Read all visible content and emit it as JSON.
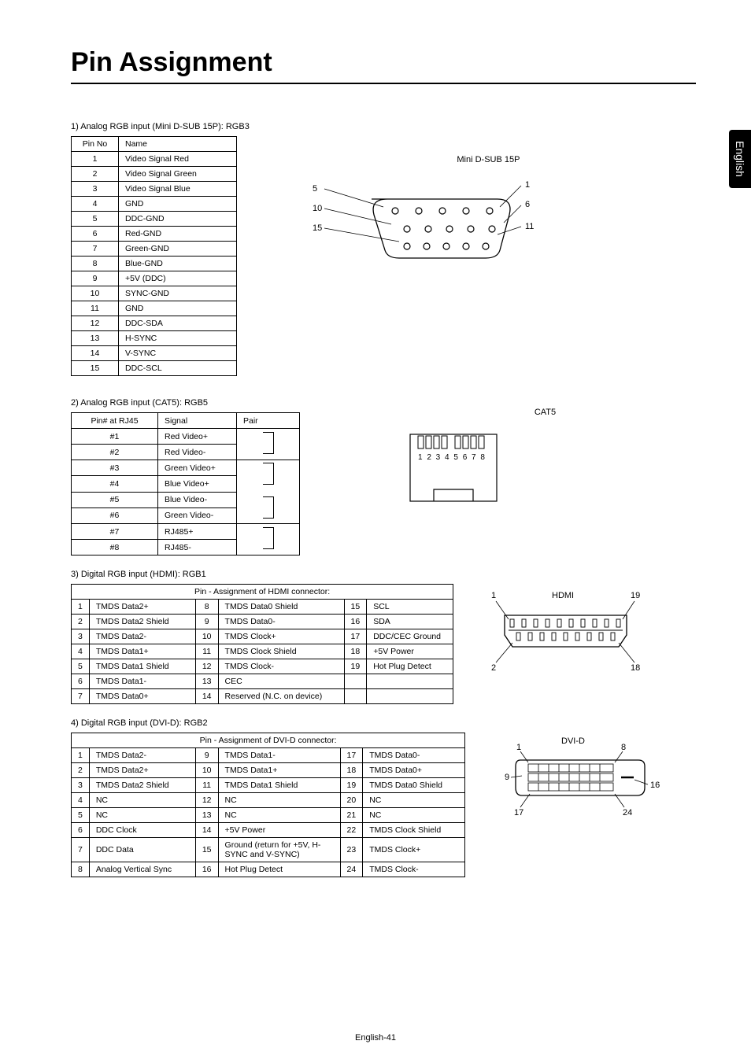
{
  "title": "Pin Assignment",
  "side_tab": "English",
  "footer": "English-41",
  "section1": {
    "label": "1)   Analog RGB input (Mini D-SUB 15P): RGB3",
    "headers": [
      "Pin No",
      "Name"
    ],
    "rows": [
      [
        "1",
        "Video Signal Red"
      ],
      [
        "2",
        "Video Signal Green"
      ],
      [
        "3",
        "Video Signal Blue"
      ],
      [
        "4",
        "GND"
      ],
      [
        "5",
        "DDC-GND"
      ],
      [
        "6",
        "Red-GND"
      ],
      [
        "7",
        "Green-GND"
      ],
      [
        "8",
        "Blue-GND"
      ],
      [
        "9",
        "+5V (DDC)"
      ],
      [
        "10",
        "SYNC-GND"
      ],
      [
        "11",
        "GND"
      ],
      [
        "12",
        "DDC-SDA"
      ],
      [
        "13",
        "H-SYNC"
      ],
      [
        "14",
        "V-SYNC"
      ],
      [
        "15",
        "DDC-SCL"
      ]
    ],
    "diag_label": "Mini D-SUB 15P",
    "diag_nums_left": [
      "5",
      "10",
      "15"
    ],
    "diag_nums_right": [
      "1",
      "6",
      "11"
    ]
  },
  "section2": {
    "label": "2)   Analog RGB input (CAT5): RGB5",
    "headers": [
      "Pin# at RJ45",
      "Signal",
      "Pair"
    ],
    "rows": [
      [
        "#1",
        "Red Video+"
      ],
      [
        "#2",
        "Red Video-"
      ],
      [
        "#3",
        "Green Video+"
      ],
      [
        "#4",
        "Blue Video+"
      ],
      [
        "#5",
        "Blue Video-"
      ],
      [
        "#6",
        "Green Video-"
      ],
      [
        "#7",
        "RJ485+"
      ],
      [
        "#8",
        "RJ485-"
      ]
    ],
    "diag_label": "CAT5",
    "diag_nums": "1 2 3 4  5 6 7 8"
  },
  "section3": {
    "label": "3)   Digital RGB input (HDMI): RGB1",
    "header": "Pin - Assignment of HDMI connector:",
    "rows": [
      [
        "1",
        "TMDS Data2+",
        "8",
        "TMDS Data0 Shield",
        "15",
        "SCL"
      ],
      [
        "2",
        "TMDS Data2 Shield",
        "9",
        "TMDS Data0-",
        "16",
        "SDA"
      ],
      [
        "3",
        "TMDS Data2-",
        "10",
        "TMDS Clock+",
        "17",
        "DDC/CEC Ground"
      ],
      [
        "4",
        "TMDS Data1+",
        "11",
        "TMDS Clock Shield",
        "18",
        "+5V Power"
      ],
      [
        "5",
        "TMDS Data1 Shield",
        "12",
        "TMDS Clock-",
        "19",
        "Hot Plug Detect"
      ],
      [
        "6",
        "TMDS Data1-",
        "13",
        "CEC",
        "",
        ""
      ],
      [
        "7",
        "TMDS Data0+",
        "14",
        "Reserved (N.C. on device)",
        "",
        ""
      ]
    ],
    "diag_label": "HDMI",
    "diag_nums": {
      "tl": "1",
      "tr": "19",
      "bl": "2",
      "br": "18"
    }
  },
  "section4": {
    "label": "4)   Digital RGB input (DVI-D): RGB2",
    "header": "Pin - Assignment of DVI-D connector:",
    "rows": [
      [
        "1",
        "TMDS Data2-",
        "9",
        "TMDS Data1-",
        "17",
        "TMDS Data0-"
      ],
      [
        "2",
        "TMDS Data2+",
        "10",
        "TMDS Data1+",
        "18",
        "TMDS Data0+"
      ],
      [
        "3",
        "TMDS Data2 Shield",
        "11",
        "TMDS Data1 Shield",
        "19",
        "TMDS Data0 Shield"
      ],
      [
        "4",
        "NC",
        "12",
        "NC",
        "20",
        "NC"
      ],
      [
        "5",
        "NC",
        "13",
        "NC",
        "21",
        "NC"
      ],
      [
        "6",
        "DDC Clock",
        "14",
        "+5V Power",
        "22",
        "TMDS Clock Shield"
      ],
      [
        "7",
        "DDC Data",
        "15",
        "Ground (return for +5V, H-SYNC and V-SYNC)",
        "23",
        "TMDS Clock+"
      ],
      [
        "8",
        "Analog Vertical Sync",
        "16",
        "Hot Plug Detect",
        "24",
        "TMDS Clock-"
      ]
    ],
    "diag_label": "DVI-D",
    "diag_nums": {
      "tl": "1",
      "tr": "8",
      "ml": "9",
      "mr": "16",
      "bl": "17",
      "br": "24"
    }
  }
}
